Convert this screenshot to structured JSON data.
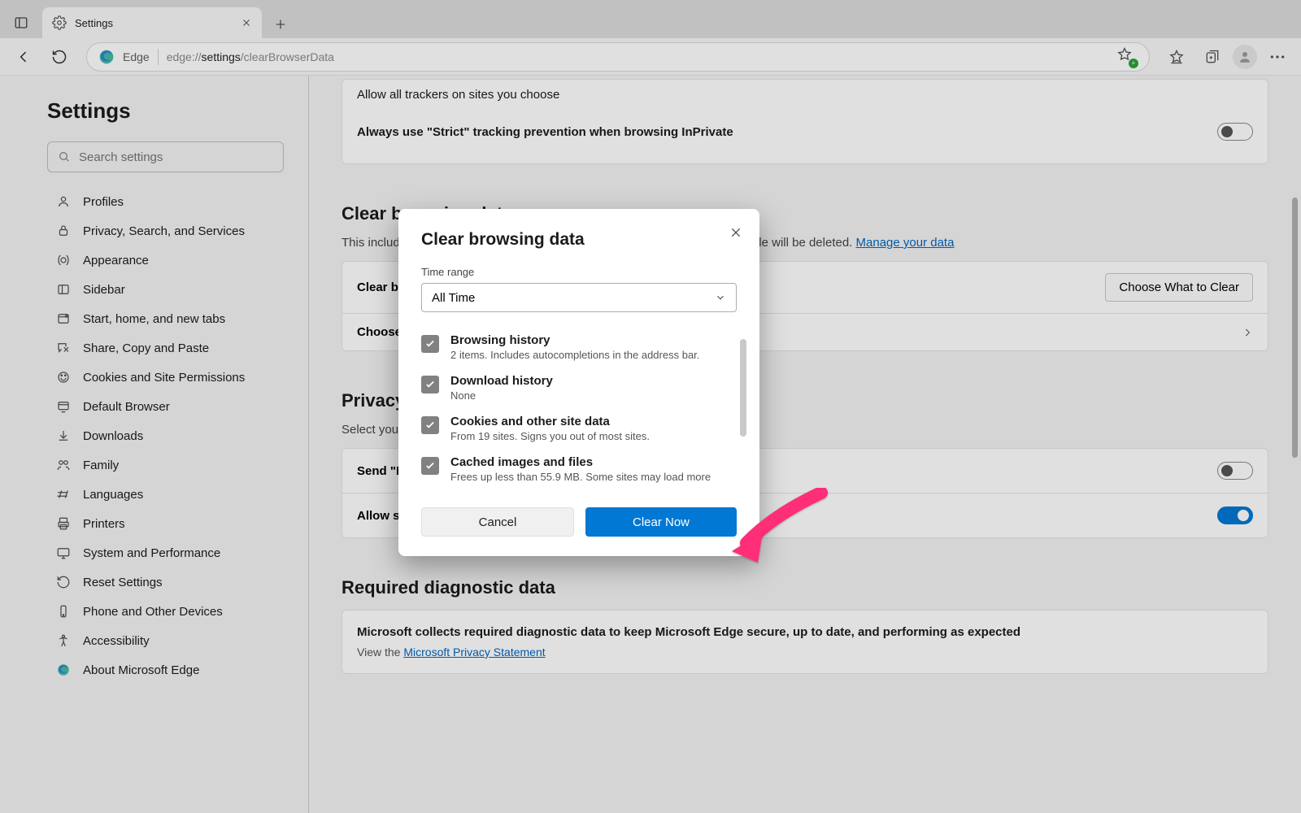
{
  "tab": {
    "title": "Settings"
  },
  "addr": {
    "brand": "Edge",
    "prefix": "edge://",
    "bold": "settings",
    "suffix": "/clearBrowserData"
  },
  "sidebar": {
    "heading": "Settings",
    "search_placeholder": "Search settings",
    "items": [
      "Profiles",
      "Privacy, Search, and Services",
      "Appearance",
      "Sidebar",
      "Start, home, and new tabs",
      "Share, Copy and Paste",
      "Cookies and Site Permissions",
      "Default Browser",
      "Downloads",
      "Family",
      "Languages",
      "Printers",
      "System and Performance",
      "Reset Settings",
      "Phone and Other Devices",
      "Accessibility",
      "About Microsoft Edge"
    ]
  },
  "page": {
    "trackers_line": "Allow all trackers on sites you choose",
    "strict_line": "Always use \"Strict\" tracking prevention when browsing InPrivate",
    "cbd": {
      "heading": "Clear browsing data",
      "desc_a": "This includes history, passwords, cookies, and more. Only data from this profile will be deleted. ",
      "desc_link": "Manage your data",
      "row1": "Clear browsing data now",
      "row1_btn": "Choose What to Clear",
      "row2": "Choose what to clear every time you close the browser"
    },
    "privacy": {
      "heading": "Privacy",
      "desc": "Select your privacy settings for Microsoft Edge.",
      "dnt": "Send \"Do Not Track\" requests",
      "allow_sites": "Allow sites to check if you have payment methods saved"
    },
    "diag": {
      "heading": "Required diagnostic data",
      "line": "Microsoft collects required diagnostic data to keep Microsoft Edge secure, up to date, and performing as expected",
      "sub_a": "View the ",
      "sub_link": "Microsoft Privacy Statement"
    }
  },
  "modal": {
    "title": "Clear browsing data",
    "time_label": "Time range",
    "time_value": "All Time",
    "options": [
      {
        "t": "Browsing history",
        "s": "2 items. Includes autocompletions in the address bar."
      },
      {
        "t": "Download history",
        "s": "None"
      },
      {
        "t": "Cookies and other site data",
        "s": "From 19 sites. Signs you out of most sites."
      },
      {
        "t": "Cached images and files",
        "s": "Frees up less than 55.9 MB. Some sites may load more"
      }
    ],
    "cancel": "Cancel",
    "clear": "Clear Now"
  }
}
